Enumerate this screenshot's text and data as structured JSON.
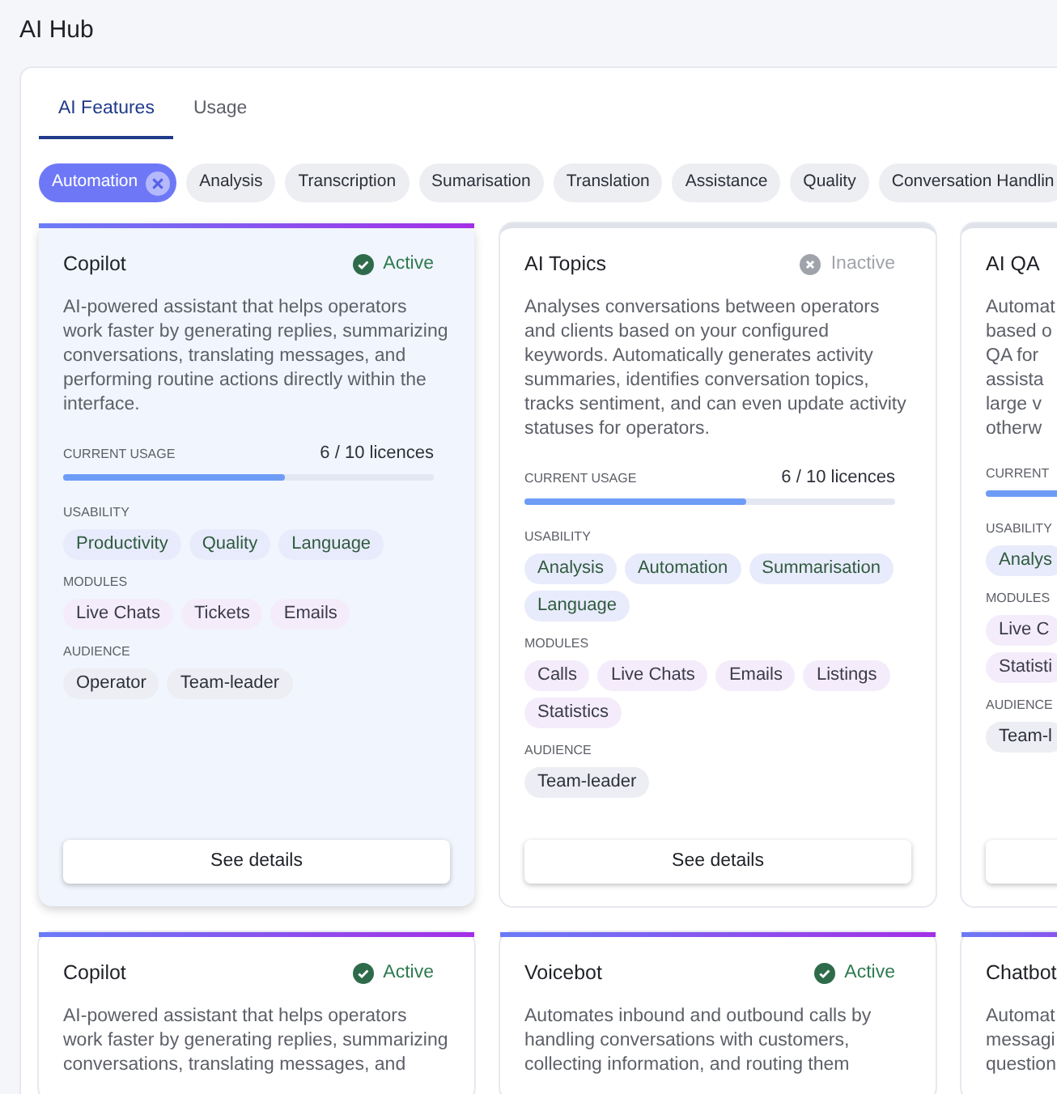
{
  "page_title": "AI Hub",
  "tabs": [
    {
      "label": "AI Features",
      "selected": true
    },
    {
      "label": "Usage",
      "selected": false
    }
  ],
  "filters": [
    {
      "label": "Automation",
      "selected": true
    },
    {
      "label": "Analysis",
      "selected": false
    },
    {
      "label": "Transcription",
      "selected": false
    },
    {
      "label": "Sumarisation",
      "selected": false
    },
    {
      "label": "Translation",
      "selected": false
    },
    {
      "label": "Assistance",
      "selected": false
    },
    {
      "label": "Quality",
      "selected": false
    },
    {
      "label": "Conversation Handlin",
      "selected": false
    }
  ],
  "card_rows": [
    [
      {
        "title": "Copilot",
        "accent": true,
        "selected": true,
        "status": {
          "label": "Active",
          "active": true
        },
        "description": "AI-powered assistant that helps operators work faster by generating replies, summarizing conversations, translating messages, and performing routine actions directly within the interface.",
        "usage": {
          "label": "CURRENT USAGE",
          "reading": "6 / 10 licences",
          "level": 0.6
        },
        "sections": [
          {
            "kind": "usability",
            "label": "USABILITY",
            "chips": [
              "Productivity",
              "Quality",
              "Language"
            ]
          },
          {
            "kind": "modules",
            "label": "MODULES",
            "chips": [
              "Live Chats",
              "Tickets",
              "Emails"
            ]
          },
          {
            "kind": "audience",
            "label": "AUDIENCE",
            "chips": [
              "Operator",
              "Team-leader"
            ]
          }
        ],
        "button": "See details"
      },
      {
        "title": "AI Topics",
        "accent": false,
        "selected": false,
        "status": {
          "label": "Inactive",
          "active": false
        },
        "description": "Analyses conversations between operators and clients based on your configured keywords. Automatically generates activity summaries, identifies conversation topics, tracks sentiment, and can even update activity statuses for operators.",
        "usage": {
          "label": "CURRENT USAGE",
          "reading": "6 / 10 licences",
          "level": 0.6
        },
        "sections": [
          {
            "kind": "usability",
            "label": "USABILITY",
            "chips": [
              "Analysis",
              "Automation",
              "Summarisation",
              "Language"
            ]
          },
          {
            "kind": "modules",
            "label": "MODULES",
            "chips": [
              "Calls",
              "Live Chats",
              "Emails",
              "Listings",
              "Statistics"
            ]
          },
          {
            "kind": "audience",
            "label": "AUDIENCE",
            "chips": [
              "Team-leader"
            ]
          }
        ],
        "button": "See details"
      },
      {
        "title": "AI QA",
        "accent": false,
        "selected": false,
        "description_lines": [
          "Automat",
          "based o",
          "QA for",
          "assista",
          "large v",
          "otherw"
        ],
        "usage": {
          "label": "CURRENT",
          "level": 0.6
        },
        "sections": [
          {
            "kind": "usability",
            "label": "USABILITY",
            "chips": [
              "Analys"
            ]
          },
          {
            "kind": "modules",
            "label": "MODULES",
            "chips": [
              "Live C",
              "Statisti"
            ]
          },
          {
            "kind": "audience",
            "label": "AUDIENCE",
            "chips": [
              "Team-l"
            ]
          }
        ]
      }
    ],
    [
      {
        "title": "Copilot",
        "accent": true,
        "selected": false,
        "status": {
          "label": "Active",
          "active": true
        },
        "description_lines": [
          "AI-powered assistant that helps operators",
          "work faster by generating replies, summarizing",
          "conversations, translating messages, and"
        ]
      },
      {
        "title": "Voicebot",
        "accent": true,
        "selected": false,
        "status": {
          "label": "Active",
          "active": true
        },
        "description_lines": [
          "Automates inbound and outbound calls by",
          "handling conversations with customers,",
          "collecting information, and routing them"
        ]
      },
      {
        "title": "Chatbot",
        "accent": true,
        "selected": false,
        "description_lines": [
          "Automat",
          "messagi",
          "question"
        ]
      }
    ]
  ]
}
